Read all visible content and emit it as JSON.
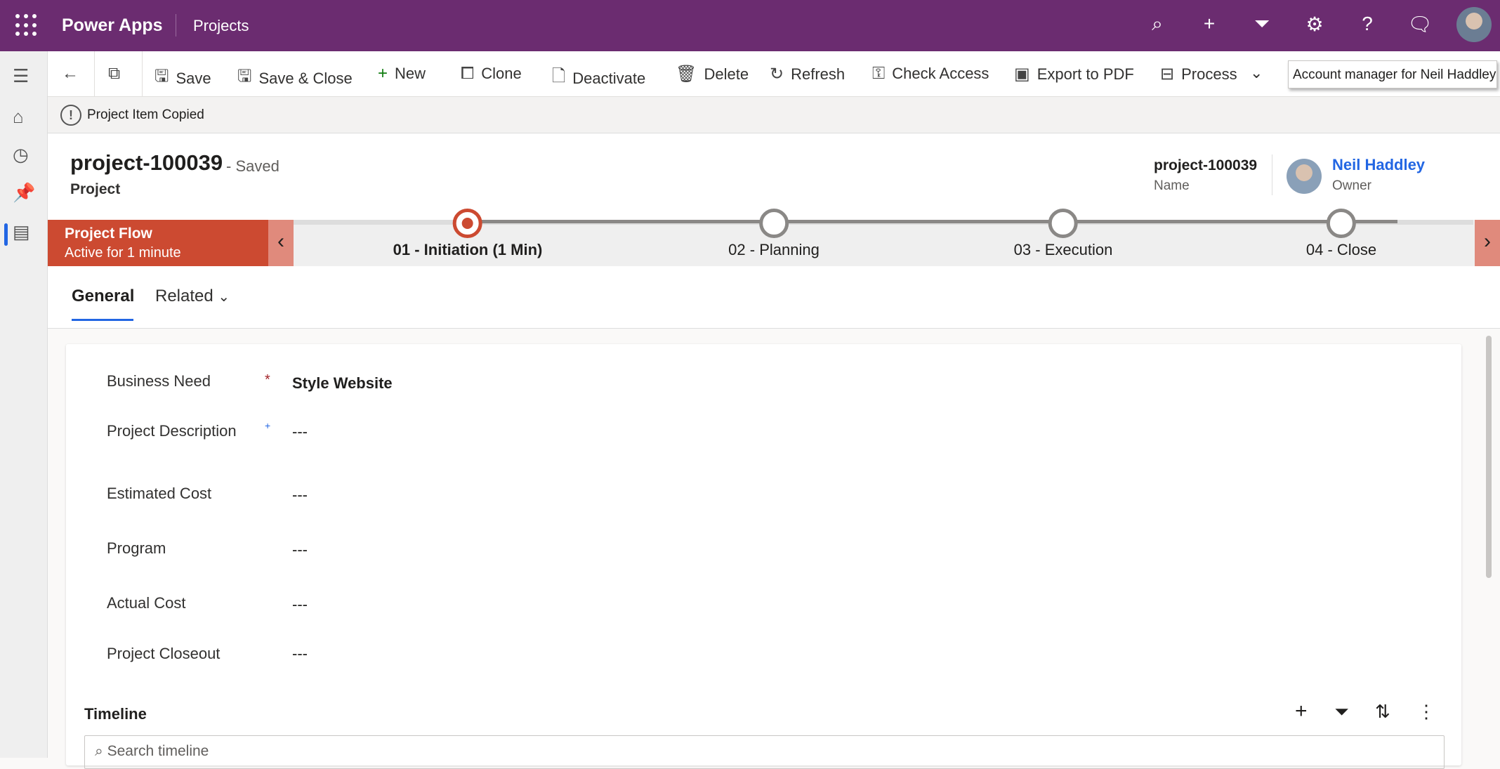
{
  "topbar": {
    "app_name": "Power Apps",
    "area": "Projects"
  },
  "commands": {
    "save": "Save",
    "save_close": "Save & Close",
    "new": "New",
    "clone": "Clone",
    "deactivate": "Deactivate",
    "delete": "Delete",
    "refresh": "Refresh",
    "check_access": "Check Access",
    "export_pdf": "Export to PDF",
    "process": "Process"
  },
  "tooltip": "Account manager for Neil Haddley",
  "notification": "Project Item Copied",
  "header": {
    "title": "project-100039",
    "status": "- Saved",
    "entity": "Project",
    "name_value": "project-100039",
    "name_label": "Name",
    "owner_value": "Neil Haddley",
    "owner_label": "Owner"
  },
  "bpf": {
    "name": "Project Flow",
    "duration": "Active for 1 minute",
    "stages": [
      {
        "label": "01 - Initiation  (1 Min)"
      },
      {
        "label": "02 - Planning"
      },
      {
        "label": "03 - Execution"
      },
      {
        "label": "04 - Close"
      }
    ]
  },
  "tabs": {
    "general": "General",
    "related": "Related"
  },
  "fields": [
    {
      "label": "Business Need",
      "value": "Style Website",
      "required": "*"
    },
    {
      "label": "Project Description",
      "value": "---",
      "required": "+"
    },
    {
      "label": "Estimated Cost",
      "value": "---"
    },
    {
      "label": "Program",
      "value": "---"
    },
    {
      "label": "Actual Cost",
      "value": "---"
    },
    {
      "label": "Project Closeout",
      "value": "---"
    }
  ],
  "timeline": {
    "title": "Timeline",
    "search_placeholder": "Search timeline"
  },
  "colors": {
    "brand": "#6b2c70",
    "bpf_active": "#cc4a31",
    "link": "#2266e3"
  }
}
